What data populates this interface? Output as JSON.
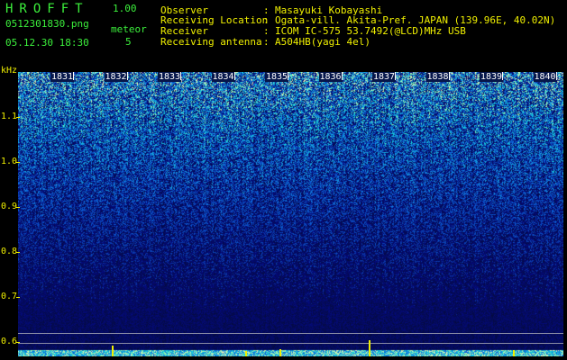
{
  "app": {
    "title": "HROFFT",
    "version": "1.00"
  },
  "file": {
    "name": "0512301830.png",
    "datetime": "05.12.30 18:30"
  },
  "meteor": {
    "label": "meteor",
    "count": "5"
  },
  "info": [
    {
      "label": "Observer",
      "value": "Masayuki Kobayashi"
    },
    {
      "label": "Receiving Location",
      "value": "Ogata-vill. Akita-Pref. JAPAN (139.96E, 40.02N)"
    },
    {
      "label": "Receiver",
      "value": "ICOM IC-575 53.7492(@LCD)MHz USB"
    },
    {
      "label": "Receiving antenna",
      "value": "A504HB(yagi 4el)"
    }
  ],
  "colors": {
    "header_green": "#3cf03c",
    "axis_yellow": "#f0f000",
    "spectrum_base": "#0a1a6e"
  },
  "axis": {
    "unit": "kHz",
    "y_ticks": [
      {
        "label": "1.1",
        "value": 1.1
      },
      {
        "label": "1.0",
        "value": 1.0
      },
      {
        "label": "0.9",
        "value": 0.9
      },
      {
        "label": "0.8",
        "value": 0.8
      },
      {
        "label": "0.7",
        "value": 0.7
      },
      {
        "label": "0.6",
        "value": 0.6
      }
    ],
    "time_labels": [
      "1831",
      "1832",
      "1833",
      "1834",
      "1835",
      "1836",
      "1837",
      "1838",
      "1839",
      "1840"
    ]
  }
}
